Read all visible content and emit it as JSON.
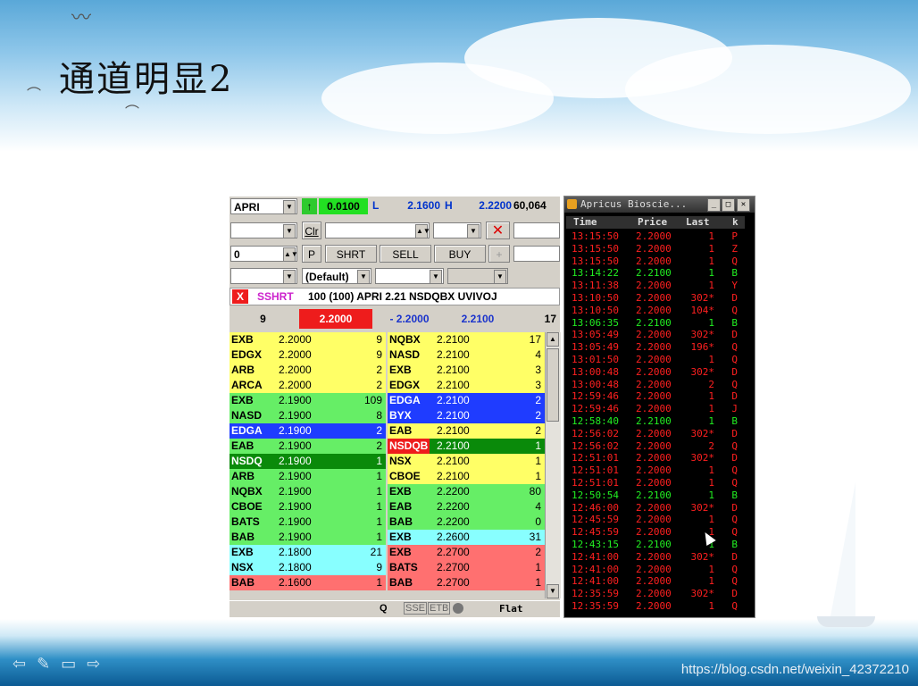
{
  "slide": {
    "title": "通道明显2",
    "watermark": "https://blog.csdn.net/weixin_42372210",
    "nav_icons": [
      "arrow-left-icon",
      "pen-icon",
      "screen-icon",
      "arrow-right-icon"
    ]
  },
  "level2": {
    "symbol": "APRI",
    "change": "0.0100",
    "low_label": "L",
    "low": "2.1600",
    "high_label": "H",
    "high": "2.2200",
    "volume": "60,064",
    "clear_label": "Clr",
    "qty_value": "0",
    "p_label": "P",
    "shrt_label": "SHRT",
    "sell_label": "SELL",
    "buy_label": "BUY",
    "plus_label": "+",
    "default_label": "(Default)",
    "order_x": "X",
    "order_side": "SSHRT",
    "order_text": "100 (100) APRI 2.21 NSDQBX UVIVOJ",
    "bid_size": "9",
    "bid": "2.2000",
    "change_quote": "- 2.2000",
    "ask": "2.2100",
    "ask_size": "17",
    "status_q": "Q",
    "status_sse": "SSE",
    "status_etb": "ETB",
    "status_flat": "Flat",
    "colors": {
      "yellow": "#ffff66",
      "green": "#66ee66",
      "blue": "#1f3cff",
      "darkgreen": "#0a8a0a",
      "red": "#ff4040",
      "cyan": "#88ffff",
      "salmon": "#ff7070"
    },
    "bids": [
      {
        "mm": "EXB",
        "price": "2.2000",
        "size": "9",
        "color": "yellow"
      },
      {
        "mm": "EDGX",
        "price": "2.2000",
        "size": "9",
        "color": "yellow"
      },
      {
        "mm": "ARB",
        "price": "2.2000",
        "size": "2",
        "color": "yellow"
      },
      {
        "mm": "ARCA",
        "price": "2.2000",
        "size": "2",
        "color": "yellow"
      },
      {
        "mm": "EXB",
        "price": "2.1900",
        "size": "109",
        "color": "green"
      },
      {
        "mm": "NASD",
        "price": "2.1900",
        "size": "8",
        "color": "green"
      },
      {
        "mm": "EDGA",
        "price": "2.1900",
        "size": "2",
        "color": "blue"
      },
      {
        "mm": "EAB",
        "price": "2.1900",
        "size": "2",
        "color": "green"
      },
      {
        "mm": "NSDQ",
        "price": "2.1900",
        "size": "1",
        "color": "darkgreen"
      },
      {
        "mm": "ARB",
        "price": "2.1900",
        "size": "1",
        "color": "green"
      },
      {
        "mm": "NQBX",
        "price": "2.1900",
        "size": "1",
        "color": "green"
      },
      {
        "mm": "CBOE",
        "price": "2.1900",
        "size": "1",
        "color": "green"
      },
      {
        "mm": "BATS",
        "price": "2.1900",
        "size": "1",
        "color": "green"
      },
      {
        "mm": "BAB",
        "price": "2.1900",
        "size": "1",
        "color": "green"
      },
      {
        "mm": "EXB",
        "price": "2.1800",
        "size": "21",
        "color": "cyan"
      },
      {
        "mm": "NSX",
        "price": "2.1800",
        "size": "9",
        "color": "cyan"
      },
      {
        "mm": "BAB",
        "price": "2.1600",
        "size": "1",
        "color": "salmon"
      }
    ],
    "asks": [
      {
        "mm": "NQBX",
        "price": "2.2100",
        "size": "17",
        "color": "yellow"
      },
      {
        "mm": "NASD",
        "price": "2.2100",
        "size": "4",
        "color": "yellow"
      },
      {
        "mm": "EXB",
        "price": "2.2100",
        "size": "3",
        "color": "yellow"
      },
      {
        "mm": "EDGX",
        "price": "2.2100",
        "size": "3",
        "color": "yellow"
      },
      {
        "mm": "EDGA",
        "price": "2.2100",
        "size": "2",
        "color": "blue"
      },
      {
        "mm": "BYX",
        "price": "2.2100",
        "size": "2",
        "color": "blue"
      },
      {
        "mm": "EAB",
        "price": "2.2100",
        "size": "2",
        "color": "yellow"
      },
      {
        "mm": "NSDQB",
        "price": "2.2100",
        "size": "1",
        "color": "darkgreen"
      },
      {
        "mm": "NSX",
        "price": "2.2100",
        "size": "1",
        "color": "yellow"
      },
      {
        "mm": "CBOE",
        "price": "2.2100",
        "size": "1",
        "color": "yellow"
      },
      {
        "mm": "EXB",
        "price": "2.2200",
        "size": "80",
        "color": "green"
      },
      {
        "mm": "EAB",
        "price": "2.2200",
        "size": "4",
        "color": "green"
      },
      {
        "mm": "BAB",
        "price": "2.2200",
        "size": "0",
        "color": "green"
      },
      {
        "mm": "EXB",
        "price": "2.2600",
        "size": "31",
        "color": "cyan"
      },
      {
        "mm": "EXB",
        "price": "2.2700",
        "size": "2",
        "color": "salmon"
      },
      {
        "mm": "BATS",
        "price": "2.2700",
        "size": "1",
        "color": "salmon"
      },
      {
        "mm": "BAB",
        "price": "2.2700",
        "size": "1",
        "color": "salmon"
      }
    ]
  },
  "time_sales": {
    "window_title": "Apricus Bioscie...",
    "headers": [
      "Time",
      "Price",
      "Last",
      "k"
    ],
    "red": "#ff2020",
    "green": "#22ee22",
    "rows": [
      {
        "time": "13:15:50",
        "price": "2.2000",
        "last": "1",
        "k": "P",
        "color": "red"
      },
      {
        "time": "13:15:50",
        "price": "2.2000",
        "last": "1",
        "k": "Z",
        "color": "red"
      },
      {
        "time": "13:15:50",
        "price": "2.2000",
        "last": "1",
        "k": "Q",
        "color": "red"
      },
      {
        "time": "13:14:22",
        "price": "2.2100",
        "last": "1",
        "k": "B",
        "color": "green"
      },
      {
        "time": "13:11:38",
        "price": "2.2000",
        "last": "1",
        "k": "Y",
        "color": "red"
      },
      {
        "time": "13:10:50",
        "price": "2.2000",
        "last": "302*",
        "k": "D",
        "color": "red"
      },
      {
        "time": "13:10:50",
        "price": "2.2000",
        "last": "104*",
        "k": "Q",
        "color": "red"
      },
      {
        "time": "13:06:35",
        "price": "2.2100",
        "last": "1",
        "k": "B",
        "color": "green"
      },
      {
        "time": "13:05:49",
        "price": "2.2000",
        "last": "302*",
        "k": "D",
        "color": "red"
      },
      {
        "time": "13:05:49",
        "price": "2.2000",
        "last": "196*",
        "k": "Q",
        "color": "red"
      },
      {
        "time": "13:01:50",
        "price": "2.2000",
        "last": "1",
        "k": "Q",
        "color": "red"
      },
      {
        "time": "13:00:48",
        "price": "2.2000",
        "last": "302*",
        "k": "D",
        "color": "red"
      },
      {
        "time": "13:00:48",
        "price": "2.2000",
        "last": "2",
        "k": "Q",
        "color": "red"
      },
      {
        "time": "12:59:46",
        "price": "2.2000",
        "last": "1",
        "k": "D",
        "color": "red"
      },
      {
        "time": "12:59:46",
        "price": "2.2000",
        "last": "1",
        "k": "J",
        "color": "red"
      },
      {
        "time": "12:58:40",
        "price": "2.2100",
        "last": "1",
        "k": "B",
        "color": "green"
      },
      {
        "time": "12:56:02",
        "price": "2.2000",
        "last": "302*",
        "k": "D",
        "color": "red"
      },
      {
        "time": "12:56:02",
        "price": "2.2000",
        "last": "2",
        "k": "Q",
        "color": "red"
      },
      {
        "time": "12:51:01",
        "price": "2.2000",
        "last": "302*",
        "k": "D",
        "color": "red"
      },
      {
        "time": "12:51:01",
        "price": "2.2000",
        "last": "1",
        "k": "Q",
        "color": "red"
      },
      {
        "time": "12:51:01",
        "price": "2.2000",
        "last": "1",
        "k": "Q",
        "color": "red"
      },
      {
        "time": "12:50:54",
        "price": "2.2100",
        "last": "1",
        "k": "B",
        "color": "green"
      },
      {
        "time": "12:46:00",
        "price": "2.2000",
        "last": "302*",
        "k": "D",
        "color": "red"
      },
      {
        "time": "12:45:59",
        "price": "2.2000",
        "last": "1",
        "k": "Q",
        "color": "red"
      },
      {
        "time": "12:45:59",
        "price": "2.2000",
        "last": "1",
        "k": "Q",
        "color": "red"
      },
      {
        "time": "12:43:15",
        "price": "2.2100",
        "last": "1",
        "k": "B",
        "color": "green"
      },
      {
        "time": "12:41:00",
        "price": "2.2000",
        "last": "302*",
        "k": "D",
        "color": "red"
      },
      {
        "time": "12:41:00",
        "price": "2.2000",
        "last": "1",
        "k": "Q",
        "color": "red"
      },
      {
        "time": "12:41:00",
        "price": "2.2000",
        "last": "1",
        "k": "Q",
        "color": "red"
      },
      {
        "time": "12:35:59",
        "price": "2.2000",
        "last": "302*",
        "k": "D",
        "color": "red"
      },
      {
        "time": "12:35:59",
        "price": "2.2000",
        "last": "1",
        "k": "Q",
        "color": "red"
      }
    ]
  }
}
